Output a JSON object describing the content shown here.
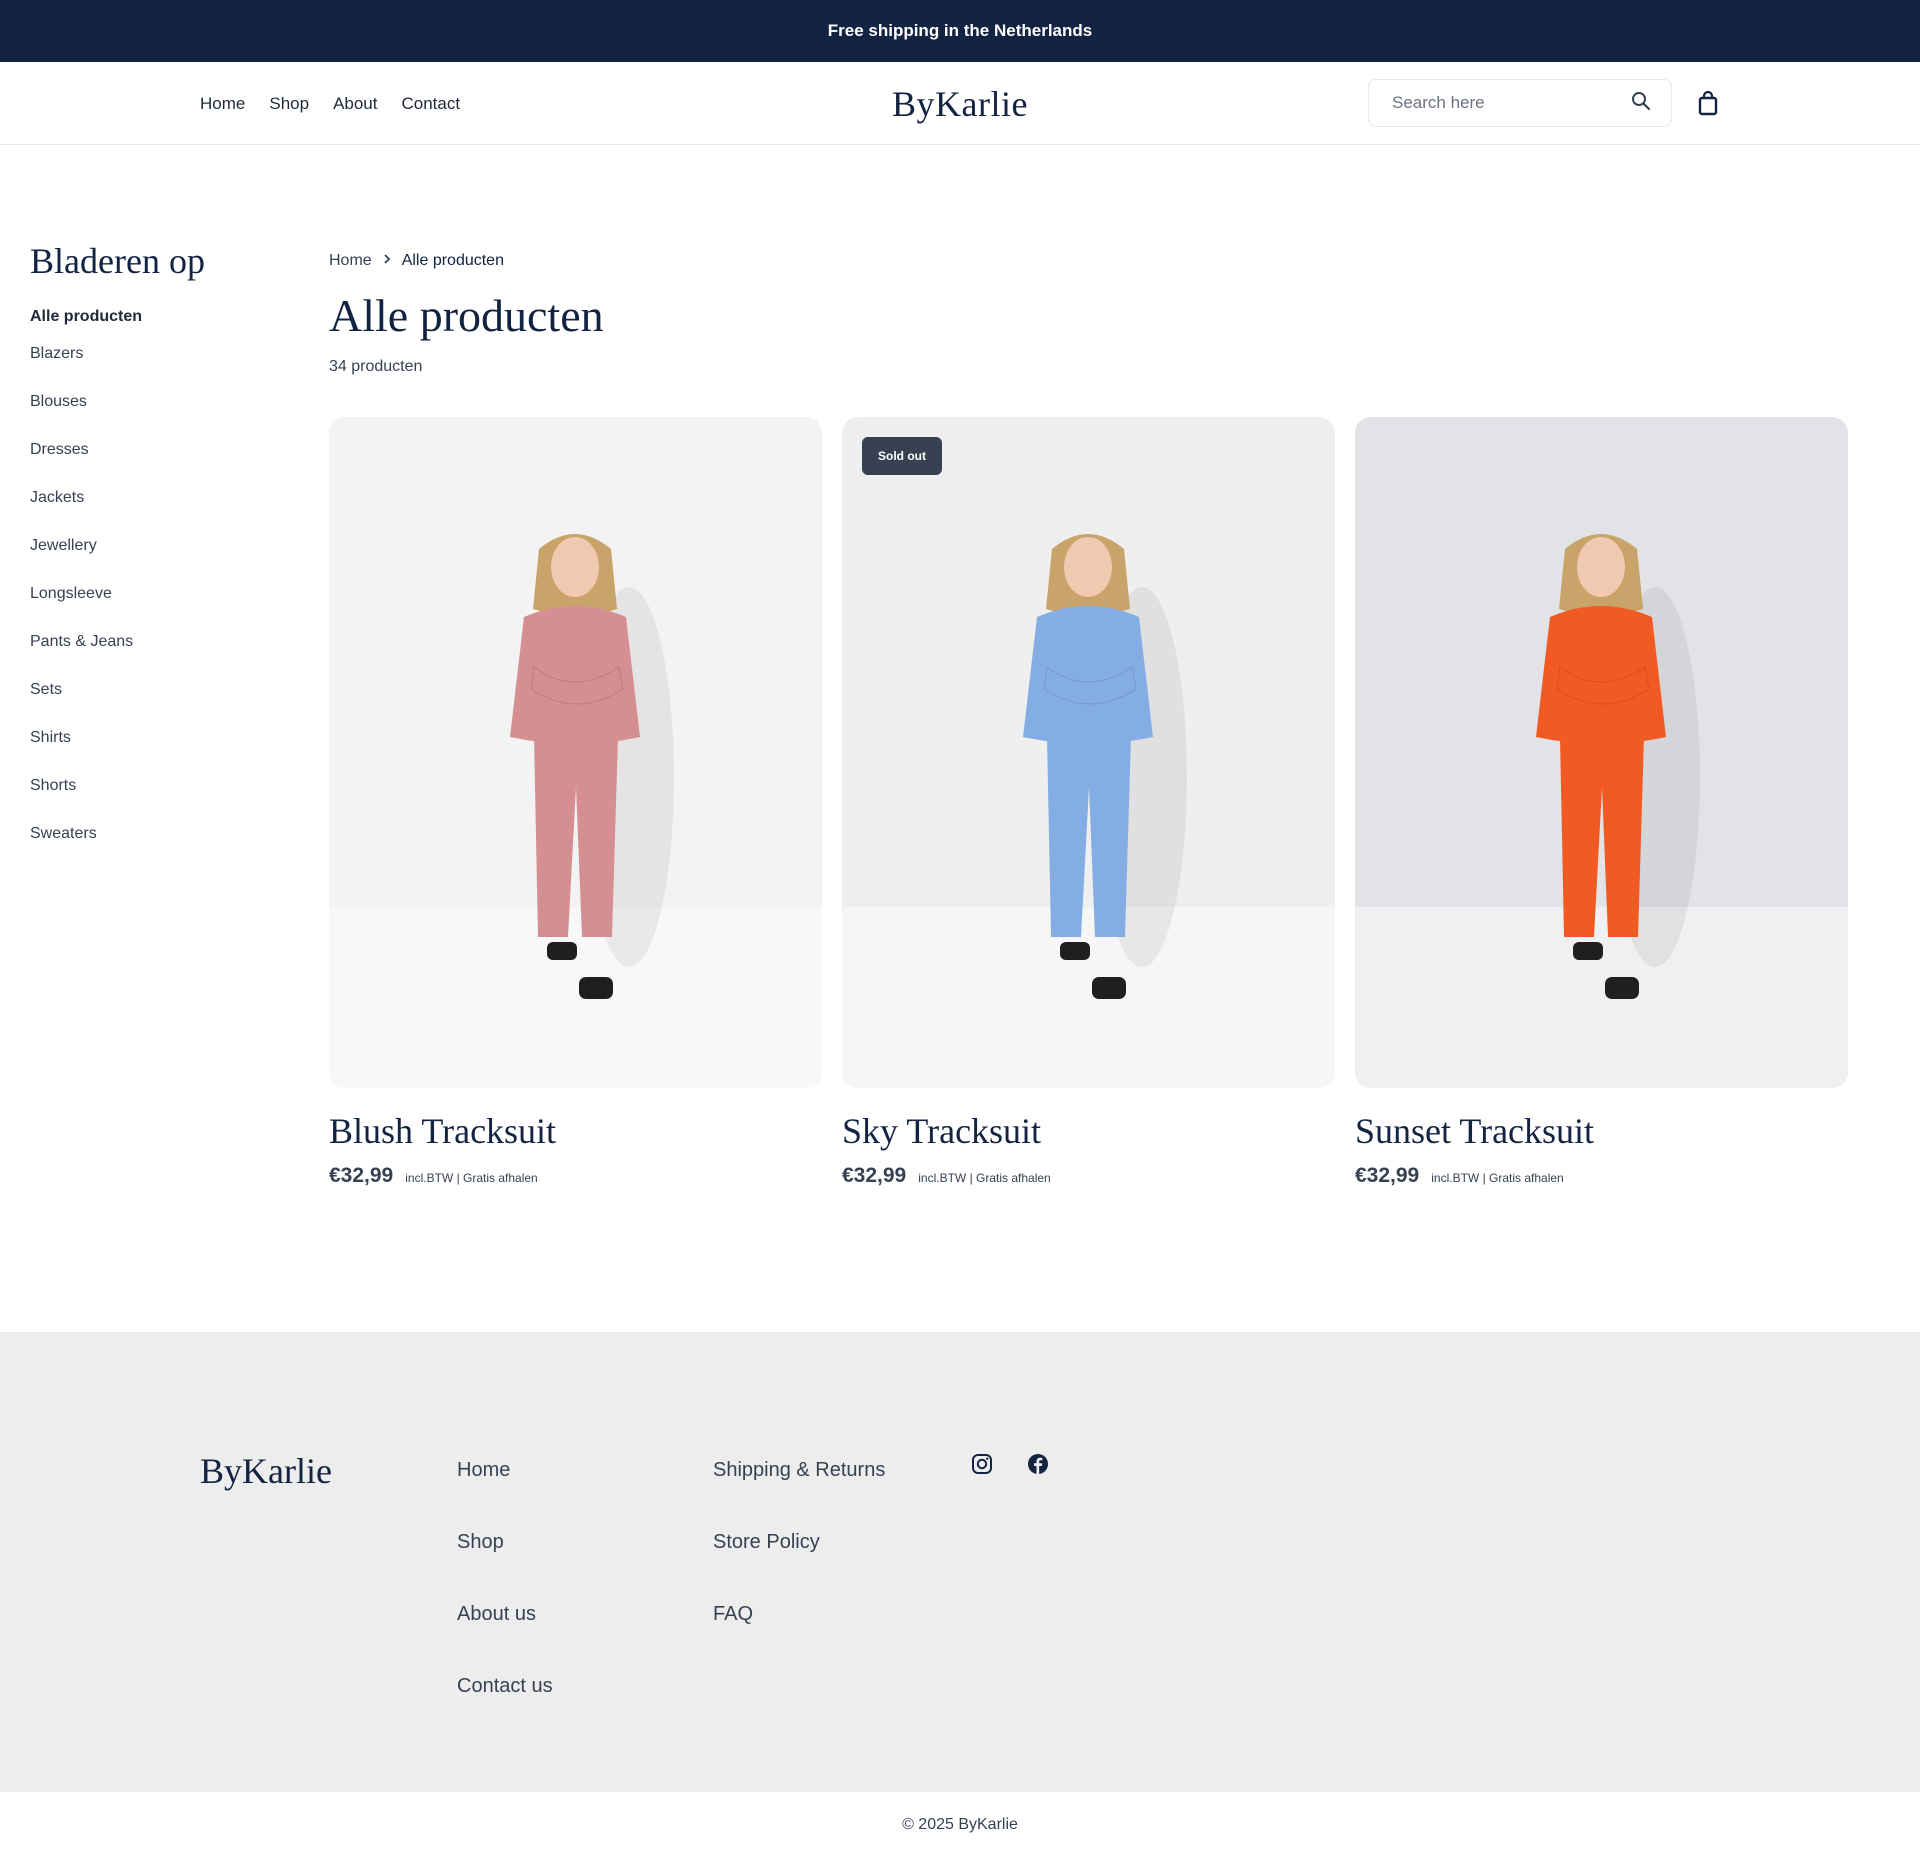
{
  "announcement": "Free shipping in the Netherlands",
  "header": {
    "nav": [
      "Home",
      "Shop",
      "About",
      "Contact"
    ],
    "logo": "ByKarlie",
    "search_placeholder": "Search here"
  },
  "sidebar": {
    "title": "Bladeren op",
    "active": "Alle producten",
    "items": [
      "Blazers",
      "Blouses",
      "Dresses",
      "Jackets",
      "Jewellery",
      "Longsleeve",
      "Pants & Jeans",
      "Sets",
      "Shirts",
      "Shorts",
      "Sweaters"
    ]
  },
  "breadcrumb": {
    "home": "Home",
    "current": "Alle producten"
  },
  "page": {
    "title": "Alle producten",
    "count": "34 producten"
  },
  "products": [
    {
      "name": "Blush Tracksuit",
      "price": "€32,99",
      "tax": "incl.BTW | Gratis afhalen",
      "badge": "",
      "color": "#d58f93",
      "bg": "#f3f3f3"
    },
    {
      "name": "Sky Tracksuit",
      "price": "€32,99",
      "tax": "incl.BTW | Gratis afhalen",
      "badge": "Sold out",
      "color": "#84aee3",
      "bg": "#efefef"
    },
    {
      "name": "Sunset Tracksuit",
      "price": "€32,99",
      "tax": "incl.BTW | Gratis afhalen",
      "badge": "",
      "color": "#f25a24",
      "bg": "#e1e3e6"
    }
  ],
  "footer": {
    "logo": "ByKarlie",
    "col1": [
      "Home",
      "Shop",
      "About us",
      "Contact us"
    ],
    "col2": [
      "Shipping & Returns",
      "Store Policy",
      "FAQ"
    ],
    "social": [
      "instagram-icon",
      "facebook-icon"
    ],
    "copyright": "© 2025 ByKarlie"
  },
  "colors": {
    "brand": "#132342",
    "footer_bg": "#ededed"
  }
}
